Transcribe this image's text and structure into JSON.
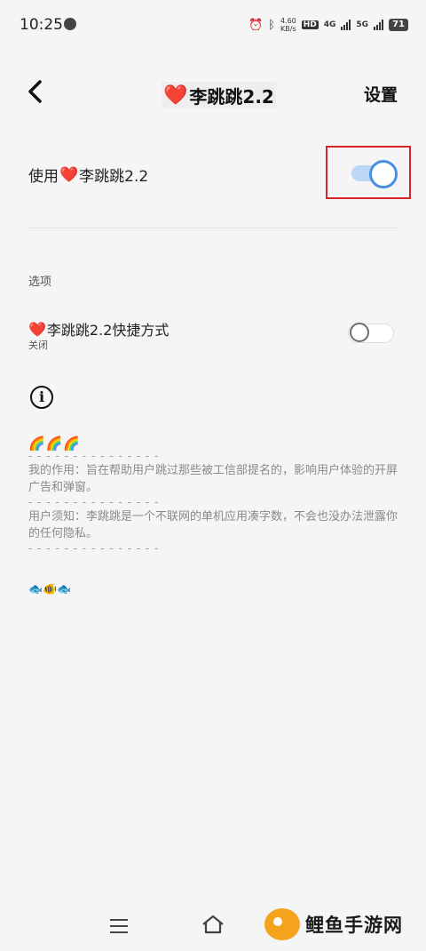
{
  "status_bar": {
    "time": "10:25",
    "speed_top": "4.60",
    "speed_bottom": "KB/s",
    "hd_label": "HD",
    "net1": "4G",
    "net2": "5G",
    "battery": "71"
  },
  "toolbar": {
    "heart": "❤️",
    "title": "李跳跳2.2",
    "settings": "设置"
  },
  "main_switch": {
    "label_prefix": "使用",
    "heart": "❤️",
    "label_suffix": "李跳跳2.2",
    "enabled": true
  },
  "options": {
    "section_title": "选项",
    "shortcut": {
      "heart": "❤️",
      "label": "李跳跳2.2快捷方式",
      "sub": "关闭",
      "enabled": false
    }
  },
  "about": {
    "rainbows": "🌈🌈🌈",
    "dash": "- - - - - - - - - - - - - - -",
    "para1": "我的作用：旨在帮助用户跳过那些被工信部提名的，影响用户体验的开屏广告和弹窗。",
    "para2": "用户须知：李跳跳是一个不联网的单机应用凑字数，不会也没办法泄露你的任何隐私。",
    "fish": "🐟🐠🐟"
  },
  "watermark": {
    "text": "鲤鱼手游网"
  },
  "colors": {
    "accent": "#4a90e2",
    "heart": "#e5202e",
    "highlight": "#d9232d"
  }
}
